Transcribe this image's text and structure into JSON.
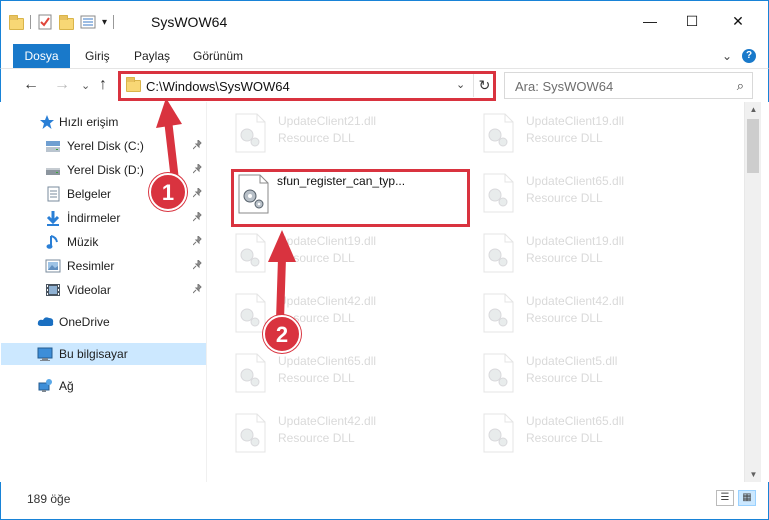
{
  "window": {
    "title": "SysWOW64",
    "minimize_glyph": "—",
    "maximize_glyph": "☐",
    "close_glyph": "✕"
  },
  "quick_access_toolbar": {
    "dropdown_glyph": "▾"
  },
  "ribbon": {
    "tabs": [
      "Dosya",
      "Giriş",
      "Paylaş",
      "Görünüm"
    ],
    "expand_glyph": "⌄",
    "help_glyph": "?"
  },
  "navigation": {
    "back_glyph": "←",
    "forward_glyph": "→",
    "recent_glyph": "⌄",
    "up_glyph": "↑",
    "address": "C:\\Windows\\SysWOW64",
    "address_dropdown_glyph": "⌄",
    "refresh_glyph": "↻",
    "search_placeholder": "Ara: SysWOW64",
    "search_glyph": "⌕"
  },
  "sidebar": {
    "items": [
      {
        "label": "Hızlı erişim",
        "icon": "star-icon",
        "pinned": false
      },
      {
        "label": "Yerel Disk (C:)",
        "icon": "drive-icon",
        "pinned": true
      },
      {
        "label": "Yerel Disk (D:)",
        "icon": "drive-icon",
        "pinned": true
      },
      {
        "label": "Belgeler",
        "icon": "document-icon",
        "pinned": true
      },
      {
        "label": "İndirmeler",
        "icon": "download-icon",
        "pinned": true
      },
      {
        "label": "Müzik",
        "icon": "music-icon",
        "pinned": true
      },
      {
        "label": "Resimler",
        "icon": "picture-icon",
        "pinned": true
      },
      {
        "label": "Videolar",
        "icon": "video-icon",
        "pinned": true
      },
      {
        "label": "OneDrive",
        "icon": "cloud-icon",
        "pinned": false
      },
      {
        "label": "Bu bilgisayar",
        "icon": "computer-icon",
        "pinned": false,
        "selected": true
      },
      {
        "label": "Ağ",
        "icon": "network-icon",
        "pinned": false
      }
    ],
    "pin_glyph": "📌"
  },
  "files": {
    "left_column": [
      {
        "name": "UpdateClient21.dll",
        "type": "Resource DLL",
        "faded": true
      },
      {
        "name": "sfun_register_can_typ...",
        "type": "",
        "faded": false,
        "highlighted": true
      },
      {
        "name": "UpdateClient19.dll",
        "type": "Resource DLL",
        "faded": true
      },
      {
        "name": "UpdateClient42.dll",
        "type": "Resource DLL",
        "faded": true
      },
      {
        "name": "UpdateClient65.dll",
        "type": "Resource DLL",
        "faded": true
      },
      {
        "name": "UpdateClient42.dll",
        "type": "Resource DLL",
        "faded": true
      }
    ],
    "right_column": [
      {
        "name": "UpdateClient19.dll",
        "type": "Resource DLL",
        "faded": true
      },
      {
        "name": "UpdateClient65.dll",
        "type": "Resource DLL",
        "faded": true
      },
      {
        "name": "UpdateClient19.dll",
        "type": "Resource DLL",
        "faded": true
      },
      {
        "name": "UpdateClient42.dll",
        "type": "Resource DLL",
        "faded": true
      },
      {
        "name": "UpdateClient5.dll",
        "type": "Resource DLL",
        "faded": true
      },
      {
        "name": "UpdateClient65.dll",
        "type": "Resource DLL",
        "faded": true
      }
    ]
  },
  "scrollbar": {
    "up_glyph": "▲",
    "down_glyph": "▼"
  },
  "status": {
    "item_count": "189 öğe"
  },
  "view_buttons": {
    "details_glyph": "☰",
    "tiles_glyph": "▦"
  },
  "annotations": [
    {
      "number": "1",
      "color": "#d9333f"
    },
    {
      "number": "2",
      "color": "#d9333f"
    }
  ],
  "colors": {
    "accent": "#1979ca",
    "highlight_red": "#d9333f",
    "selection": "#cce8ff"
  }
}
